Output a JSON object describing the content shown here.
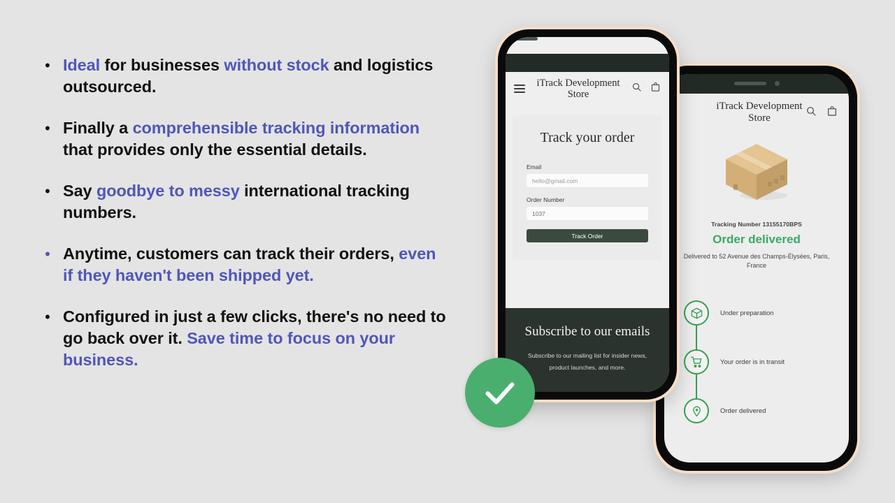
{
  "theme": {
    "background": "#e4e4e4",
    "accent_blue": "#5156b8",
    "text_dark": "#111111",
    "green_success": "#3aa967",
    "green_badge": "#4aaf6e",
    "dark_green": "#2b332e",
    "button_green": "#3b4a3e",
    "phone_frame_border": "#f7ddc8"
  },
  "bullets": [
    {
      "dot_color": "dark",
      "segments": [
        {
          "text": "Ideal",
          "accent": true
        },
        {
          "text": " for businesses ",
          "accent": false
        },
        {
          "text": "without stock",
          "accent": true
        },
        {
          "text": " and logistics outsourced.",
          "accent": false
        }
      ]
    },
    {
      "dot_color": "dark",
      "segments": [
        {
          "text": "Finally a ",
          "accent": false
        },
        {
          "text": "comprehensible tracking information",
          "accent": true
        },
        {
          "text": " that provides only the essential details.",
          "accent": false
        }
      ]
    },
    {
      "dot_color": "dark",
      "segments": [
        {
          "text": "Say ",
          "accent": false
        },
        {
          "text": "goodbye to messy",
          "accent": true
        },
        {
          "text": " international tracking numbers.",
          "accent": false
        }
      ]
    },
    {
      "dot_color": "accent",
      "segments": [
        {
          "text": "Anytime, customers can track their orders, ",
          "accent": false
        },
        {
          "text": "even if they haven't been shipped yet.",
          "accent": true
        }
      ]
    },
    {
      "dot_color": "dark",
      "segments": [
        {
          "text": "Configured in just a few clicks, there's no need to go back over it. ",
          "accent": false
        },
        {
          "text": "Save time to focus on your business.",
          "accent": true
        }
      ]
    }
  ],
  "bullet_marker": "•",
  "phone_front": {
    "header": {
      "menu_icon": "hamburger-menu-icon",
      "brand": "iTrack Development Store",
      "search_icon": "search-icon",
      "cart_icon": "shopping-bag-icon"
    },
    "form": {
      "title": "Track your order",
      "email_label": "Email",
      "email_placeholder": "hello@gmail.com",
      "order_label": "Order Number",
      "order_value": "1037",
      "submit_label": "Track Order"
    },
    "subscribe": {
      "title": "Subscribe to our emails",
      "copy": "Subscribe to our mailing list for insider news, product launches, and more."
    }
  },
  "phone_back": {
    "header": {
      "brand": "iTrack Development Store",
      "search_icon": "search-icon",
      "cart_icon": "shopping-bag-icon"
    },
    "package_icon": "cardboard-box-illustration",
    "tracking_number_line": "Tracking Number 13155170BPS",
    "status": "Order delivered",
    "address": "Delivered to 52 Avenue des Champs-Élysées, Paris, France",
    "timeline": [
      {
        "icon": "package-box-icon",
        "label": "Under preparation"
      },
      {
        "icon": "shopping-cart-icon",
        "label": "Your order is in transit"
      },
      {
        "icon": "location-pin-icon",
        "label": "Order delivered"
      }
    ]
  },
  "badge": {
    "icon": "check-circle-icon"
  }
}
